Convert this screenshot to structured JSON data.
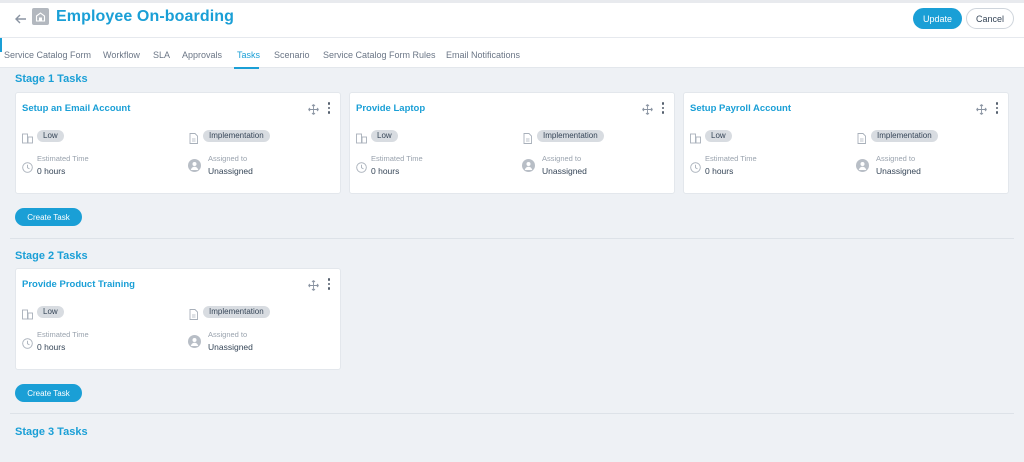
{
  "header": {
    "title": "Employee On-boarding",
    "update_label": "Update",
    "cancel_label": "Cancel",
    "accent_color": "#1a9fd6"
  },
  "tabs": [
    {
      "label": "Service Catalog Form",
      "active": false
    },
    {
      "label": "Workflow",
      "active": false
    },
    {
      "label": "SLA",
      "active": false
    },
    {
      "label": "Approvals",
      "active": false
    },
    {
      "label": "Tasks",
      "active": true
    },
    {
      "label": "Scenario",
      "active": false
    },
    {
      "label": "Service Catalog Form Rules",
      "active": false
    },
    {
      "label": "Email Notifications",
      "active": false
    }
  ],
  "stages": [
    {
      "title": "Stage 1 Tasks",
      "create_label": "Create Task",
      "tasks": [
        {
          "title": "Setup an Email Account",
          "priority": "Low",
          "type": "Implementation",
          "est_label": "Estimated Time",
          "est_value": "0 hours",
          "assigned_label": "Assigned to",
          "assigned_value": "Unassigned"
        },
        {
          "title": "Provide Laptop",
          "priority": "Low",
          "type": "Implementation",
          "est_label": "Estimated Time",
          "est_value": "0 hours",
          "assigned_label": "Assigned to",
          "assigned_value": "Unassigned"
        },
        {
          "title": "Setup Payroll Account",
          "priority": "Low",
          "type": "Implementation",
          "est_label": "Estimated Time",
          "est_value": "0 hours",
          "assigned_label": "Assigned to",
          "assigned_value": "Unassigned"
        }
      ]
    },
    {
      "title": "Stage 2 Tasks",
      "create_label": "Create Task",
      "tasks": [
        {
          "title": "Provide Product Training",
          "priority": "Low",
          "type": "Implementation",
          "est_label": "Estimated Time",
          "est_value": "0 hours",
          "assigned_label": "Assigned to",
          "assigned_value": "Unassigned"
        }
      ]
    },
    {
      "title": "Stage 3 Tasks",
      "tasks": []
    }
  ],
  "icons": {
    "back": "arrow-left-icon",
    "page": "catalog-icon",
    "move": "move-icon",
    "more": "kebab-icon",
    "priority": "priority-icon",
    "type": "document-icon",
    "time": "clock-icon",
    "user": "user-avatar-icon"
  }
}
